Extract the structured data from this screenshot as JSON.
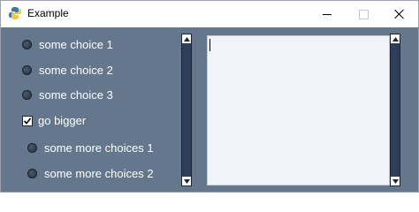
{
  "window": {
    "title": "Example"
  },
  "radio_group_1": [
    {
      "label": "some choice 1",
      "selected": false
    },
    {
      "label": "some choice 2",
      "selected": false
    },
    {
      "label": "some choice 3",
      "selected": false
    }
  ],
  "checkbox": {
    "label": "go bigger",
    "checked": true
  },
  "radio_group_2": [
    {
      "label": "some more choices 1",
      "selected": false
    },
    {
      "label": "some more choices 2",
      "selected": false
    }
  ],
  "multiline": {
    "value": ""
  },
  "colors": {
    "window_bg": "#64778d",
    "scrollbar": "#2c3e5a",
    "text_area_bg": "#f0f3f8"
  }
}
